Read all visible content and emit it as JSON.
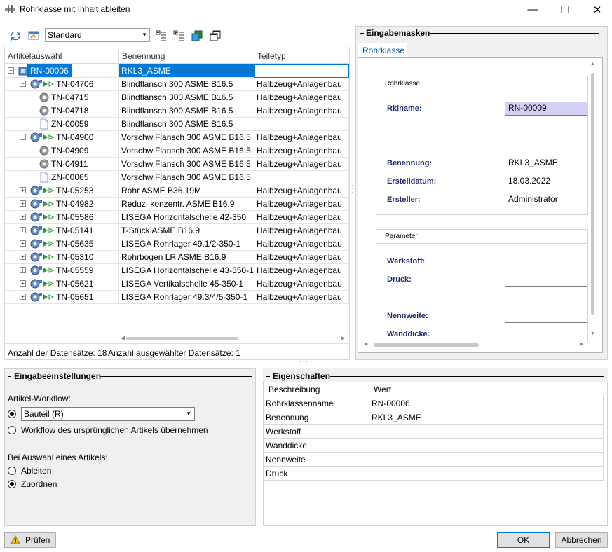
{
  "window": {
    "title": "Rohrklasse mit Inhalt ableiten",
    "minimize": "—",
    "maximize": "☐",
    "close": "✕"
  },
  "toolbar": {
    "view_selected": "Standard"
  },
  "grid": {
    "columns": [
      "Artikelauswahl",
      "Benennung",
      "Teiletyp"
    ],
    "rows": [
      {
        "level": 0,
        "expander": "−",
        "icon": "assembly",
        "id": "RN-00006",
        "name": "RKL3_ASME",
        "type": "",
        "selected": true
      },
      {
        "level": 1,
        "expander": "−",
        "icon": "gear-group",
        "id": "TN-04706",
        "name": "Blindflansch 300 ASME B16.5",
        "type": "Halbzeug+Anlagenbau"
      },
      {
        "level": 2,
        "expander": "",
        "icon": "gear",
        "id": "TN-04715",
        "name": "Blindflansch 300 ASME B16.5",
        "type": "Halbzeug+Anlagenbau"
      },
      {
        "level": 2,
        "expander": "",
        "icon": "gear",
        "id": "TN-04718",
        "name": "Blindflansch 300 ASME B16.5",
        "type": "Halbzeug+Anlagenbau"
      },
      {
        "level": 2,
        "expander": "",
        "icon": "doc",
        "id": "ZN-00059",
        "name": "Blindflansch 300 ASME B16.5",
        "type": ""
      },
      {
        "level": 1,
        "expander": "−",
        "icon": "gear-group",
        "id": "TN-04900",
        "name": "Vorschw.Flansch 300 ASME B16.5",
        "type": "Halbzeug+Anlagenbau"
      },
      {
        "level": 2,
        "expander": "",
        "icon": "gear",
        "id": "TN-04909",
        "name": "Vorschw.Flansch 300 ASME B16.5",
        "type": "Halbzeug+Anlagenbau"
      },
      {
        "level": 2,
        "expander": "",
        "icon": "gear",
        "id": "TN-04911",
        "name": "Vorschw.Flansch 300 ASME B16.5",
        "type": "Halbzeug+Anlagenbau"
      },
      {
        "level": 2,
        "expander": "",
        "icon": "doc",
        "id": "ZN-00065",
        "name": "Vorschw.Flansch 300 ASME B16.5",
        "type": ""
      },
      {
        "level": 1,
        "expander": "+",
        "icon": "gear-group",
        "id": "TN-05253",
        "name": "Rohr ASME B36.19M",
        "type": "Halbzeug+Anlagenbau"
      },
      {
        "level": 1,
        "expander": "+",
        "icon": "gear-group",
        "id": "TN-04982",
        "name": "Reduz. konzentr. ASME B16.9",
        "type": "Halbzeug+Anlagenbau"
      },
      {
        "level": 1,
        "expander": "+",
        "icon": "gear-group",
        "id": "TN-05586",
        "name": "LISEGA Horizontalschelle 42-350",
        "type": "Halbzeug+Anlagenbau"
      },
      {
        "level": 1,
        "expander": "+",
        "icon": "gear-group",
        "id": "TN-05141",
        "name": "T-Stück ASME B16.9",
        "type": "Halbzeug+Anlagenbau"
      },
      {
        "level": 1,
        "expander": "+",
        "icon": "gear-group",
        "id": "TN-05635",
        "name": "LISEGA Rohrlager 49.1/2-350-1",
        "type": "Halbzeug+Anlagenbau"
      },
      {
        "level": 1,
        "expander": "+",
        "icon": "gear-group",
        "id": "TN-05310",
        "name": "Rohrbogen LR ASME B16.9",
        "type": "Halbzeug+Anlagenbau"
      },
      {
        "level": 1,
        "expander": "+",
        "icon": "gear-group",
        "id": "TN-05559",
        "name": "LISEGA Horizontalschelle 43-350-1",
        "type": "Halbzeug+Anlagenbau"
      },
      {
        "level": 1,
        "expander": "+",
        "icon": "gear-group",
        "id": "TN-05621",
        "name": "LISEGA Vertikalschelle 45-350-1",
        "type": "Halbzeug+Anlagenbau"
      },
      {
        "level": 1,
        "expander": "+",
        "icon": "gear-group",
        "id": "TN-05651",
        "name": "LISEGA Rohrlager 49.3/4/5-350-1",
        "type": "Halbzeug+Anlagenbau"
      }
    ],
    "status_count": "Anzahl der Datensätze: 18",
    "status_selected": "Anzahl ausgewählter Datensätze: 1"
  },
  "eingabemasken": {
    "title": "Eingabemasken",
    "tab": "Rohrklasse",
    "group_rohrklasse": "Rohrklasse",
    "fields": {
      "rklname_label": "Rklname:",
      "rklname_value": "RN-00009",
      "benennung_label": "Benennung:",
      "benennung_value": "RKL3_ASME",
      "erstelldatum_label": "Erstelldatum:",
      "erstelldatum_value": "18.03.2022",
      "ersteller_label": "Ersteller:",
      "ersteller_value": "Administrator"
    },
    "group_parameter": "Parameter",
    "params": {
      "werkstoff_label": "Werkstoff:",
      "druck_label": "Druck:",
      "nennweite_label": "Nennweite:",
      "wanddicke_label": "Wanddicke:"
    }
  },
  "eingabeeinstellungen": {
    "title": "Eingabeeinstellungen",
    "workflow_label": "Artikel-Workflow:",
    "workflow_value": "Bauteil (R)",
    "workflow_option_original": "Workflow des ursprünglichen Artikels übernehmen",
    "auswahl_label": "Bei Auswahl eines Artikels:",
    "option_ableiten": "Ableiten",
    "option_zuordnen": "Zuordnen"
  },
  "eigenschaften": {
    "title": "Eigenschaften",
    "columns": [
      "Beschreibung",
      "Wert"
    ],
    "rows": [
      {
        "key": "Rohrklassenname",
        "value": "RN-00006"
      },
      {
        "key": "Benennung",
        "value": "RKL3_ASME"
      },
      {
        "key": "Werkstoff",
        "value": ""
      },
      {
        "key": "Wanddicke",
        "value": ""
      },
      {
        "key": "Nennweite",
        "value": ""
      },
      {
        "key": "Druck",
        "value": ""
      }
    ]
  },
  "buttons": {
    "pruefen": "Prüfen",
    "ok": "OK",
    "abbrechen": "Abbrechen"
  },
  "colors": {
    "selection": "#0078d7",
    "field_label": "#1d2a6b",
    "tab_text": "#0b5b9e",
    "highlight_field": "#d3d0f5"
  }
}
